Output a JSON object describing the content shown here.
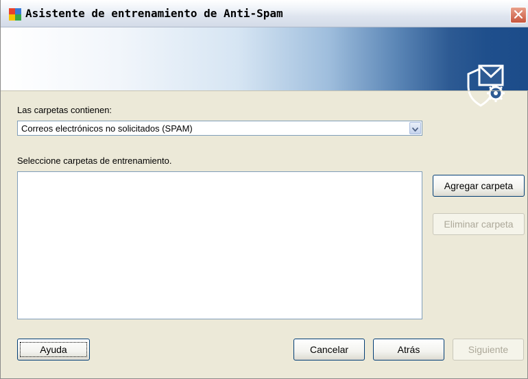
{
  "window": {
    "title": "Asistente de entrenamiento de Anti-Spam",
    "app_icon": "avg-logo-icon",
    "close_icon": "close-icon"
  },
  "banner": {
    "icon": "shield-envelope-gear-icon",
    "colors": {
      "start": "#ffffff",
      "end": "#1c4c8a"
    }
  },
  "form": {
    "folders_contain_label": "Las carpetas contienen:",
    "folder_type_select": {
      "selected": "Correos electrónicos no solicitados (SPAM)"
    },
    "select_folders_label": "Seleccione carpetas de entrenamiento.",
    "folders_list": []
  },
  "side_buttons": {
    "add_folder": "Agregar carpeta",
    "remove_folder": "Eliminar carpeta"
  },
  "footer": {
    "help": "Ayuda",
    "cancel": "Cancelar",
    "back": "Atrás",
    "next": "Siguiente"
  },
  "colors": {
    "face": "#ece9d8",
    "field_border": "#7f9db9",
    "button_border": "#003c74",
    "disabled_text": "#aca899"
  }
}
